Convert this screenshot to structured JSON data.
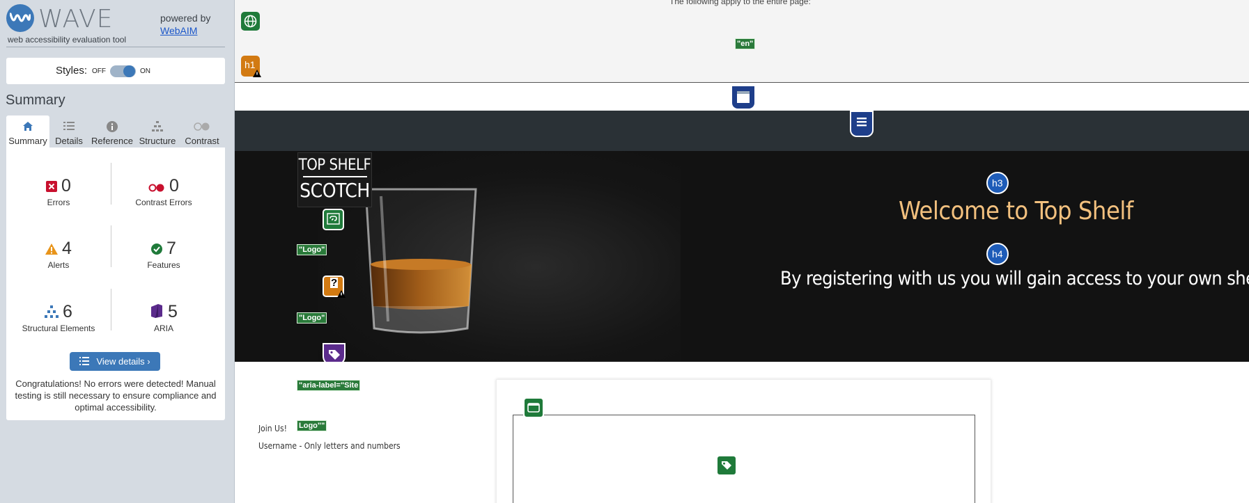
{
  "wave": {
    "brand": "WAVE",
    "tagline": "web accessibility evaluation tool",
    "powered_by": "powered by",
    "webaim_link": "WebAIM",
    "styles_label": "Styles:",
    "toggle_off": "OFF",
    "toggle_on": "ON",
    "styles_enabled": true,
    "summary_title": "Summary",
    "tabs": [
      {
        "label": "Summary",
        "icon": "home-icon",
        "active": true
      },
      {
        "label": "Details",
        "icon": "list-icon",
        "active": false
      },
      {
        "label": "Reference",
        "icon": "info-icon",
        "active": false
      },
      {
        "label": "Structure",
        "icon": "hierarchy-icon",
        "active": false
      },
      {
        "label": "Contrast",
        "icon": "contrast-icon",
        "active": false
      }
    ],
    "stats": {
      "errors": {
        "count": "0",
        "label": "Errors"
      },
      "contrast_errors": {
        "count": "0",
        "label": "Contrast Errors"
      },
      "alerts": {
        "count": "4",
        "label": "Alerts"
      },
      "features": {
        "count": "7",
        "label": "Features"
      },
      "structural": {
        "count": "6",
        "label": "Structural Elements"
      },
      "aria": {
        "count": "5",
        "label": "ARIA"
      }
    },
    "view_details": "View details ›",
    "congrats": "Congratulations! No errors were detected! Manual testing is still necessary to ensure compliance and optimal accessibility."
  },
  "page": {
    "doc_text": "The following apply to the entire page:",
    "lang_tag": "\"en\"",
    "h1_badge": "h1",
    "logo_top": "TOP SHELF",
    "logo_bottom": "SCOTCH",
    "logo_alt_1": "\"Logo\"",
    "logo_alt_2": "\"Logo\"",
    "aria_label_1": "\"aria-label=\"Site",
    "aria_label_2": "Logo\"\"",
    "h3_badge": "h3",
    "h4_badge": "h4",
    "hero_title": "Welcome to Top Shelf",
    "hero_subtitle": "By registering with us you will gain access to your own shelf",
    "join_us": "Join Us!",
    "username_label": "Username - Only letters and numbers"
  },
  "colors": {
    "wave_blue": "#3c78b8",
    "error_red": "#c8102e",
    "alert_orange": "#e8941a",
    "feature_green": "#1f7a3a",
    "aria_purple": "#5b2b8c",
    "hero_title": "#f2c07e"
  }
}
